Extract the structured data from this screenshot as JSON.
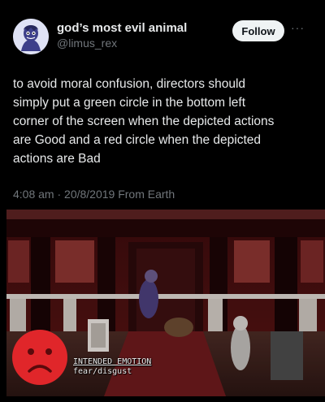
{
  "author": {
    "display_name": "god’s most evil animal",
    "handle": "@limus_rex",
    "avatar_icon": "user-avatar-icon"
  },
  "actions": {
    "follow_label": "Follow",
    "more_label": "···"
  },
  "tweet": {
    "text": "to avoid moral confusion, directors should\nsimply put a green circle in the bottom left\ncorner of the screen when the depicted actions\nare Good and a red circle when the depicted\nactions are Bad",
    "meta": "4:08 am · 20/8/2019 From Earth"
  },
  "media": {
    "caption_line1": "INTENDED EMOTION",
    "caption_line2": "fear/disgust",
    "indicator_icon": "red-sad-face-icon",
    "indicator_color": "#e0262a"
  },
  "colors": {
    "background": "#000000",
    "text": "#e7e9ea",
    "muted": "#71767b",
    "follow_bg": "#eff3f4"
  }
}
